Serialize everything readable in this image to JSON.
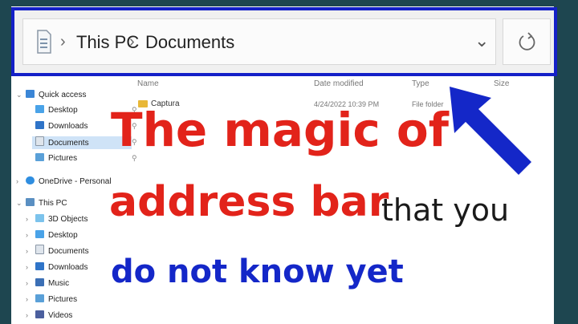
{
  "address_bar": {
    "crumbs": [
      "This PC",
      "Documents"
    ]
  },
  "file_list": {
    "headers": [
      "Name",
      "Date modified",
      "Type",
      "Size"
    ],
    "rows": [
      {
        "name": "Captura",
        "date": "4/24/2022 10:39 PM",
        "type": "File folder"
      }
    ]
  },
  "nav_pane": {
    "quick_access": "Quick access",
    "quick_items": [
      "Desktop",
      "Downloads",
      "Documents",
      "Pictures"
    ],
    "onedrive": "OneDrive - Personal",
    "this_pc": "This PC",
    "pc_items": [
      "3D Objects",
      "Desktop",
      "Documents",
      "Downloads",
      "Music",
      "Pictures",
      "Videos"
    ]
  },
  "overlay": {
    "line1": "The magic of",
    "line2": "address bar",
    "line2b": "that you",
    "line3": "do not know yet"
  },
  "colors": {
    "frame": "#1420c8",
    "red_text": "#e2231a",
    "blue_text": "#1427c8",
    "border": "#1e4650"
  }
}
